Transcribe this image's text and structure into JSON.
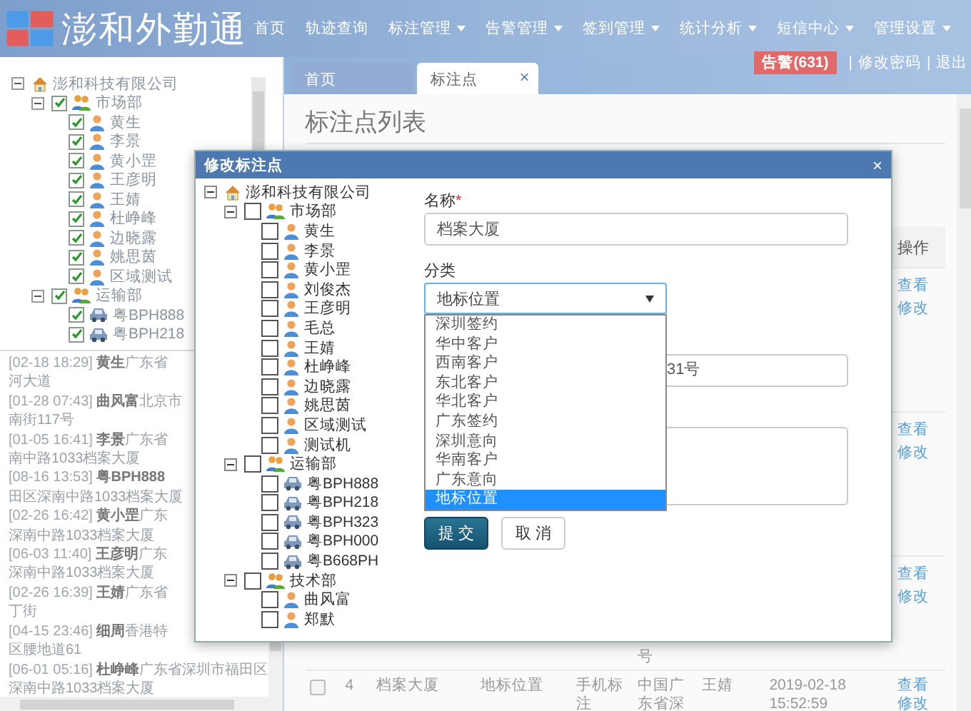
{
  "header": {
    "logo": "澎和外勤通",
    "nav": [
      {
        "label": "首页",
        "dropdown": false
      },
      {
        "label": "轨迹查询",
        "dropdown": false
      },
      {
        "label": "标注管理",
        "dropdown": true
      },
      {
        "label": "告警管理",
        "dropdown": true
      },
      {
        "label": "签到管理",
        "dropdown": true
      },
      {
        "label": "统计分析",
        "dropdown": true
      },
      {
        "label": "短信中心",
        "dropdown": true
      },
      {
        "label": "管理设置",
        "dropdown": true
      }
    ]
  },
  "left_panel": {
    "tree": {
      "label": "澎和科技有限公司",
      "kind": "org",
      "expanded": true,
      "children": [
        {
          "label": "市场部",
          "kind": "group",
          "checked": true,
          "expanded": true,
          "children": [
            {
              "label": "黄生",
              "kind": "person",
              "checked": true
            },
            {
              "label": "李景",
              "kind": "person",
              "checked": true
            },
            {
              "label": "黄小罡",
              "kind": "person",
              "checked": true
            },
            {
              "label": "王彦明",
              "kind": "person",
              "checked": true
            },
            {
              "label": "王婧",
              "kind": "person",
              "checked": true
            },
            {
              "label": "杜峥峰",
              "kind": "person",
              "checked": true
            },
            {
              "label": "边晓露",
              "kind": "person",
              "checked": true
            },
            {
              "label": "姚思茵",
              "kind": "person",
              "checked": true
            },
            {
              "label": "区域测试",
              "kind": "person",
              "checked": true
            }
          ]
        },
        {
          "label": "运输部",
          "kind": "group",
          "checked": true,
          "expanded": true,
          "children": [
            {
              "label": "粤BPH888",
              "kind": "car",
              "checked": true
            },
            {
              "label": "粤BPH218",
              "kind": "car",
              "checked": true
            }
          ]
        }
      ]
    },
    "log": [
      {
        "time": "[02-18 18:29]",
        "name": "黄生",
        "place": "广东省",
        "continuation": "河大道"
      },
      {
        "time": "[01-28 07:43]",
        "name": "曲风富",
        "place": "北京市",
        "continuation": "南街117号"
      },
      {
        "time": "[01-05 16:41]",
        "name": "李景",
        "place": "广东省",
        "continuation": "南中路1033档案大厦"
      },
      {
        "time": "[08-16 13:53]",
        "name": "粤BPH888",
        "continuation": "田区深南中路1033档案大厦"
      },
      {
        "time": "[02-26 16:42]",
        "name": "黄小罡",
        "place": "广东",
        "continuation": "深南中路1033档案大厦"
      },
      {
        "time": "[06-03 11:40]",
        "name": "王彦明",
        "place": "广东",
        "continuation": "深南中路1033档案大厦"
      },
      {
        "time": "[02-26 16:39]",
        "name": "王婧",
        "place": "广东省",
        "continuation": "丁街"
      },
      {
        "time": "[04-15 23:46]",
        "name": "细周",
        "place": "香港特",
        "continuation": "区腰地道61"
      },
      {
        "time": "[06-01 05:16]",
        "name": "杜峥峰",
        "place": "广东省深圳市福田区",
        "continuation": "深南中路1033档案大厦"
      }
    ]
  },
  "tabs": [
    {
      "label": "首页",
      "selected": false,
      "closable": false
    },
    {
      "label": "标注点",
      "selected": true,
      "closable": true,
      "close": "×"
    }
  ],
  "top_links": {
    "alarm": "告警(631)",
    "separator": "|",
    "links": [
      "修改密码",
      "退出"
    ]
  },
  "page_title": "标注点列表",
  "table": {
    "action_header": "操作",
    "rows": [
      {
        "actions": [
          "查看",
          "修改"
        ]
      },
      {
        "actions": [
          "查看",
          "修改"
        ]
      },
      {
        "address": "号",
        "actions": [
          "查看",
          "修改"
        ]
      },
      {
        "checked": false,
        "index": "4",
        "name": "档案大厦",
        "category": "地标位置",
        "source": "手机标注",
        "address": "中国广东省深",
        "person": "王婧",
        "time": "2019-02-18 15:52:59",
        "actions": [
          "查看",
          "修改"
        ]
      }
    ]
  },
  "modal": {
    "title": "修改标注点",
    "close": "×",
    "tree": {
      "label": "澎和科技有限公司",
      "kind": "org",
      "expanded": true,
      "children": [
        {
          "label": "市场部",
          "kind": "group",
          "checked": false,
          "expanded": true,
          "children": [
            {
              "label": "黄生",
              "kind": "person",
              "checked": false
            },
            {
              "label": "李景",
              "kind": "person",
              "checked": false
            },
            {
              "label": "黄小罡",
              "kind": "person",
              "checked": false
            },
            {
              "label": "刘俊杰",
              "kind": "person",
              "checked": false
            },
            {
              "label": "王彦明",
              "kind": "person",
              "checked": false
            },
            {
              "label": "毛总",
              "kind": "person",
              "checked": false
            },
            {
              "label": "王婧",
              "kind": "person",
              "checked": false
            },
            {
              "label": "杜峥峰",
              "kind": "person",
              "checked": false
            },
            {
              "label": "边晓露",
              "kind": "person",
              "checked": false
            },
            {
              "label": "姚思茵",
              "kind": "person",
              "checked": false
            },
            {
              "label": "区域测试",
              "kind": "person",
              "checked": false
            },
            {
              "label": "测试机",
              "kind": "person",
              "checked": false
            }
          ]
        },
        {
          "label": "运输部",
          "kind": "group",
          "checked": false,
          "expanded": true,
          "children": [
            {
              "label": "粤BPH888",
              "kind": "car",
              "checked": false
            },
            {
              "label": "粤BPH218",
              "kind": "car",
              "checked": false
            },
            {
              "label": "粤BPH323",
              "kind": "car",
              "checked": false
            },
            {
              "label": "粤BPH000",
              "kind": "car",
              "checked": false
            },
            {
              "label": "粤B668PH",
              "kind": "car",
              "checked": false
            }
          ]
        },
        {
          "label": "技术部",
          "kind": "group",
          "checked": false,
          "expanded": true,
          "children": [
            {
              "label": "曲风富",
              "kind": "person",
              "checked": false
            },
            {
              "label": "郑默",
              "kind": "person",
              "checked": false
            }
          ]
        }
      ]
    },
    "form": {
      "name": {
        "label": "名称",
        "required": true,
        "required_mark": "*",
        "value": "档案大厦"
      },
      "category": {
        "label": "分类",
        "value": "地标位置",
        "open": true,
        "options": [
          {
            "label": "深圳签约",
            "selected": false
          },
          {
            "label": "华中客户",
            "selected": false
          },
          {
            "label": "西南客户",
            "selected": false
          },
          {
            "label": "东北客户",
            "selected": false
          },
          {
            "label": "华北客户",
            "selected": false
          },
          {
            "label": "广东签约",
            "selected": false
          },
          {
            "label": "深圳意向",
            "selected": false
          },
          {
            "label": "华南客户",
            "selected": false
          },
          {
            "label": "广东意向",
            "selected": false
          },
          {
            "label": "地标位置",
            "selected": true
          }
        ]
      },
      "address": {
        "value": "31号"
      }
    },
    "buttons": [
      {
        "label": "提 交",
        "kind": "primary"
      },
      {
        "label": "取 消",
        "kind": "default"
      }
    ]
  }
}
